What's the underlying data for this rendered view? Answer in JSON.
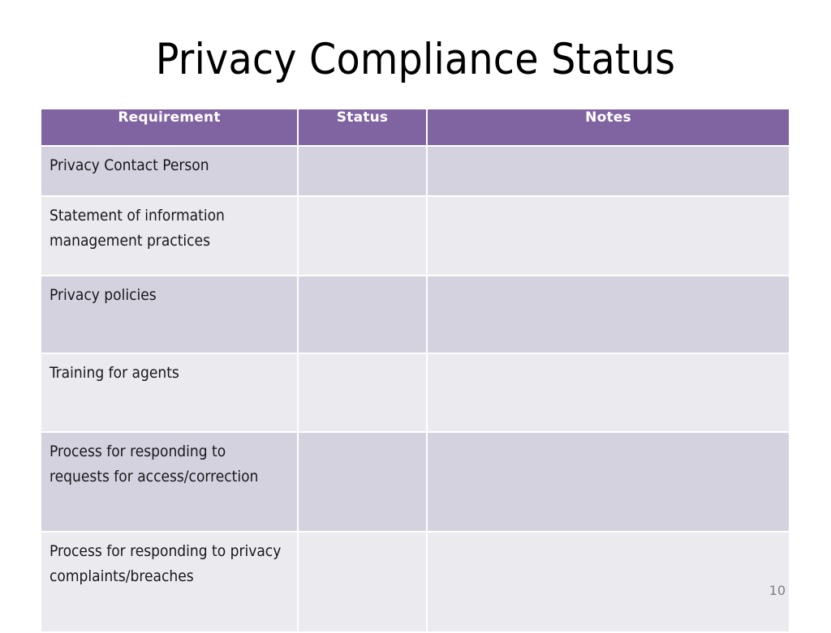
{
  "slide": {
    "title": "Privacy Compliance Status",
    "number": "10",
    "colors": {
      "header_purple": "#8064A2",
      "band_row": "#D4D2DF",
      "light_row": "#EBEAEF",
      "header_text": "#FFFFFF",
      "body_text": "#17171A",
      "slide_number_text": "#808080",
      "background": "#FFFFFF"
    }
  },
  "table": {
    "columns": [
      {
        "label": "Requirement",
        "align": "center"
      },
      {
        "label": "Status",
        "align": "center"
      },
      {
        "label": "Notes",
        "align": "center"
      }
    ],
    "rows": [
      {
        "requirement": "Privacy Contact Person",
        "status": "",
        "notes": "",
        "shade": "band"
      },
      {
        "requirement": "Statement of information management practices",
        "status": "",
        "notes": "",
        "shade": "light"
      },
      {
        "requirement": "Privacy policies",
        "status": "",
        "notes": "",
        "shade": "band"
      },
      {
        "requirement": "Training for agents",
        "status": "",
        "notes": "",
        "shade": "light"
      },
      {
        "requirement": "Process for responding to requests for access/correction",
        "status": "",
        "notes": "",
        "shade": "band"
      },
      {
        "requirement": "Process for responding to privacy complaints/breaches",
        "status": "",
        "notes": "",
        "shade": "light"
      }
    ]
  }
}
